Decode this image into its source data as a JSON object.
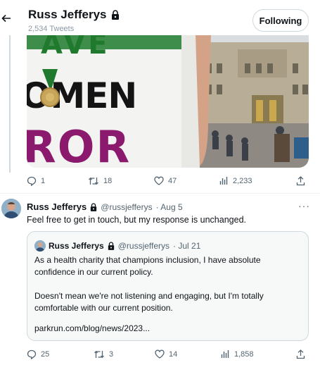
{
  "header": {
    "name": "Russ Jefferys",
    "tweet_count": "2,534 Tweets",
    "follow_label": "Following",
    "back_icon": "arrow-left-icon",
    "lock_icon": "lock-icon"
  },
  "media_post": {
    "actions": {
      "replies": "1",
      "retweets": "18",
      "likes": "47",
      "views": "2,233"
    }
  },
  "tweet": {
    "name": "Russ Jefferys",
    "handle": "@russjefferys",
    "date": "· Aug 5",
    "more": "···",
    "text": "Feel free to get in touch, but my response is unchanged.",
    "quote": {
      "name": "Russ Jefferys",
      "handle": "@russjefferys",
      "date": "· Jul 21",
      "line1": "As a health charity that champions inclusion, I have absolute",
      "line2": "confidence in our current policy.",
      "line3": "Doesn't mean we're not listening and engaging, but I'm totally",
      "line4": "comfortable with our current position.",
      "link": "parkrun.com/blog/news/2023..."
    },
    "actions": {
      "replies": "25",
      "retweets": "3",
      "likes": "14",
      "views": "1,858"
    }
  },
  "colors": {
    "text": "#0f1419",
    "muted": "#536471",
    "border": "#cfd9de",
    "shirt_green": "#1f7a2e",
    "shirt_magenta": "#8b1a6e"
  }
}
